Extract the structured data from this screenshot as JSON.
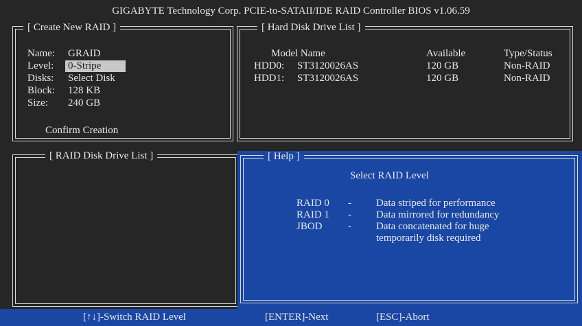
{
  "window": {
    "title": "GIGABYTE Technology Corp. PCIE-to-SATAII/IDE RAID Controller BIOS v1.06.59"
  },
  "create_raid": {
    "title": "[ Create New RAID ]",
    "fields": [
      {
        "label": "Name:",
        "value": "GRAID"
      },
      {
        "label": "Level:",
        "value": "0-Stripe"
      },
      {
        "label": "Disks:",
        "value": "Select Disk"
      },
      {
        "label": "Block:",
        "value": "128 KB"
      },
      {
        "label": "Size:",
        "value": "240 GB"
      }
    ],
    "confirm_label": "Confirm Creation"
  },
  "hdd_list": {
    "title": "[ Hard Disk Drive List ]",
    "headers": {
      "model": "Model Name",
      "available": "Available",
      "type": "Type/Status"
    },
    "rows": [
      {
        "id": "HDD0:",
        "model": "ST3120026AS",
        "available": "120 GB",
        "type": "Non-RAID"
      },
      {
        "id": "HDD1:",
        "model": "ST3120026AS",
        "available": "120 GB",
        "type": "Non-RAID"
      }
    ]
  },
  "raid_list": {
    "title": "[ RAID Disk Drive List ]"
  },
  "help": {
    "title": "[ Help ]",
    "heading": "Select RAID Level",
    "items": [
      {
        "level": "RAID 0",
        "sep": "-",
        "desc": "Data striped for performance"
      },
      {
        "level": "RAID 1",
        "sep": "-",
        "desc": "Data mirrored for redundancy"
      },
      {
        "level": "JBOD",
        "sep": "-",
        "desc": "Data concatenated for huge"
      }
    ],
    "continuation": "temporarily disk required"
  },
  "statusbar": {
    "switch": "[↑↓]-Switch RAID Level",
    "next": "[ENTER]-Next",
    "abort": "[ESC]-Abort"
  },
  "colors": {
    "background": "#262626",
    "help_background": "#1a47a3",
    "highlight": "#c8c8c8",
    "text": "#e8e8e8"
  }
}
